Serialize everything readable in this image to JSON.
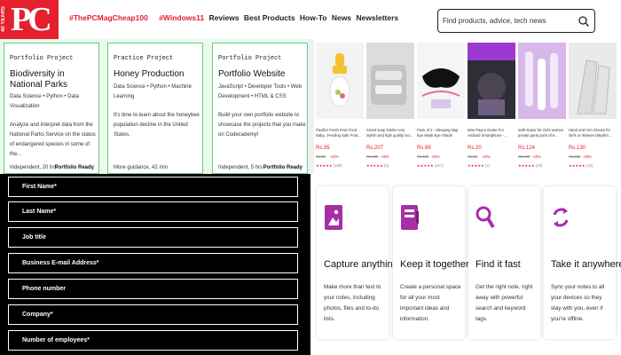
{
  "brand": {
    "logo_text": "PC",
    "logo_side_text": "40 YEARS",
    "accent": "#e4202e"
  },
  "nav": {
    "hot_links": [
      "#ThePCMagCheap100",
      "#Windows11"
    ],
    "links": [
      "Reviews",
      "Best Products",
      "How-To",
      "News",
      "Newsletters"
    ],
    "search_placeholder": "Find products, advice, tech news",
    "search_icon": "search-icon"
  },
  "projects": [
    {
      "type": "Portfolio Project",
      "title": "Biodiversity in National Parks",
      "tags": "Data Science • Python • Data Visualization",
      "description": "Analyze and interpret data from the National Parks Service on the status of endangered species in some of the...",
      "meta": "Independent, 20 hrs",
      "badge": "Portfolio Ready"
    },
    {
      "type": "Practice Project",
      "title": "Honey Production",
      "tags": "Data Science • Python • Machine Learning",
      "description": "It's time to learn about the honeybee population decline in the United States.",
      "meta": "More guidance, 42 min",
      "badge": ""
    },
    {
      "type": "Portfolio Project",
      "title": "Portfolio Website",
      "tags": "JavaScript • Developer Tools • Web Development • HTML & CSS",
      "description": "Build your own portfolio website to showcase the projects that you make on Codecademy!",
      "meta": "Independent, 5 hrs",
      "badge": "Portfolio Ready"
    }
  ],
  "products": [
    {
      "name": "Pacifier Fresh Fruit Food Baby...Feeding Safe Fruit...",
      "price": "Rs.95",
      "old": "Rs.98",
      "discount": "-62%",
      "stars": "★★★★★",
      "count": "(186)"
    },
    {
      "name": "Smart soap holder very stylish and high quality loo...",
      "price": "Rs.207",
      "old": "Rs.385",
      "discount": "-46%",
      "stars": "★★★★★",
      "count": "(4)"
    },
    {
      "name": "Pack of 2 - Sleeping Nap Eye Mask Eye Shade Cove...",
      "price": "Rs.99",
      "old": "Rs.199",
      "discount": "-50%",
      "stars": "★★★★★",
      "count": "(221)"
    },
    {
      "name": "Max Payne Game For Android Smartphone -...",
      "price": "Rs.20",
      "old": "Rs.30",
      "discount": "-33%",
      "stars": "★★★★★",
      "count": "(7)"
    },
    {
      "name": "Sofit Razor for Girls women private parts pack of 6...",
      "price": "Rs.124",
      "old": "Rs.208",
      "discount": "-40%",
      "stars": "★★★★★",
      "count": "(23)"
    },
    {
      "name": "Hand and Arm Gloves for Girls or Women (Muslim...",
      "price": "Rs.130",
      "old": "Rs.250",
      "discount": "-48%",
      "stars": "★★★★★",
      "count": "(22)"
    }
  ],
  "form": {
    "fields": [
      "First Name*",
      "Last Name*",
      "Job title",
      "Business E-mail Address*",
      "Phone number",
      "Company*",
      "Number of employees*"
    ]
  },
  "features": [
    {
      "icon": "document-icon",
      "title": "Capture anything",
      "description": "Make more than text to your notes, including photos, files and to-do lists."
    },
    {
      "icon": "notebook-icon",
      "title": "Keep it together",
      "description": "Create a personal space for all your most important ideas and information."
    },
    {
      "icon": "search-icon",
      "title": "Find it fast",
      "description": "Get the right note, right away with powerful search and keyword tags."
    },
    {
      "icon": "sync-icon",
      "title": "Take it anywhere",
      "description": "Sync your notes to all your devices so they stay with you, even if you're offline."
    }
  ],
  "colors": {
    "project_bg": "#eafbea",
    "project_border": "#68c88f",
    "feature_icon": "#a62fa6",
    "form_bg": "#000000"
  }
}
